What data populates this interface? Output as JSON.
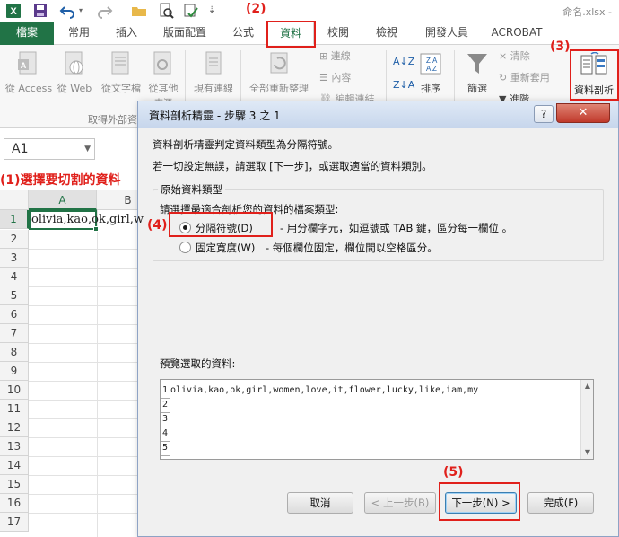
{
  "titlebar": {
    "doc_title": "命名.xlsx -"
  },
  "tabs": [
    {
      "label": "檔案"
    },
    {
      "label": "常用"
    },
    {
      "label": "插入"
    },
    {
      "label": "版面配置"
    },
    {
      "label": "公式"
    },
    {
      "label": "資料"
    },
    {
      "label": "校閱"
    },
    {
      "label": "檢視"
    },
    {
      "label": "開發人員"
    },
    {
      "label": "ACROBAT"
    }
  ],
  "ribbon": {
    "from_access": "從 Access",
    "from_web": "從 Web",
    "from_text": "從文字檔",
    "from_other": "從其他",
    "from_other_2": "來源",
    "existing": "現有連線",
    "refresh_all": "全部重新整理",
    "connections": "連線",
    "properties": "內容",
    "edit_links": "編輯連結",
    "group_external": "取得外部資",
    "sort": "排序",
    "filter": "篩選",
    "clear": "清除",
    "reapply": "重新套用",
    "advanced": "進階",
    "text_to_columns": "資料剖析"
  },
  "formula_bar": {
    "name_box": "A1"
  },
  "sheet": {
    "columns": [
      "A",
      "B"
    ],
    "rows": [
      "1",
      "2",
      "3",
      "4",
      "5",
      "6",
      "7",
      "8",
      "9",
      "10",
      "11",
      "12",
      "13",
      "14",
      "15",
      "16",
      "17"
    ],
    "a1_value": "olivia,kao,ok,girl,w"
  },
  "annotations": {
    "a1": "(1)選擇要切割的資料",
    "a2": "(2)",
    "a3": "(3)",
    "a4": "(4)",
    "a5": "(5)"
  },
  "dialog": {
    "title": "資料剖析精靈 - 步驟 3 之 1",
    "help": "?",
    "close": "✕",
    "line1": "資料剖析精靈判定資料類型為分隔符號。",
    "line2": "若一切設定無誤，請選取 [下一步]，或選取適當的資料類別。",
    "group_label": "原始資料類型",
    "group_prompt": "請選擇最適合剖析您的資料的檔案類型:",
    "opt_delimited": "分隔符號(D)",
    "opt_delimited_desc": "- 用分欄字元，如逗號或 TAB 鍵，區分每一欄位 。",
    "opt_fixed": "固定寬度(W)",
    "opt_fixed_desc": "- 每個欄位固定，欄位間以空格區分。",
    "preview_label": "預覽選取的資料:",
    "preview_rows": [
      {
        "n": "1",
        "text": "olivia,kao,ok,girl,women,love,it,flower,lucky,like,iam,my"
      },
      {
        "n": "2",
        "text": ""
      },
      {
        "n": "3",
        "text": ""
      },
      {
        "n": "4",
        "text": ""
      },
      {
        "n": "5",
        "text": ""
      }
    ],
    "btn_cancel": "取消",
    "btn_back": "< 上一步(B)",
    "btn_next": "下一步(N) >",
    "btn_finish": "完成(F)"
  },
  "colors": {
    "excel_green": "#217346",
    "annotation_red": "#e0201b"
  }
}
